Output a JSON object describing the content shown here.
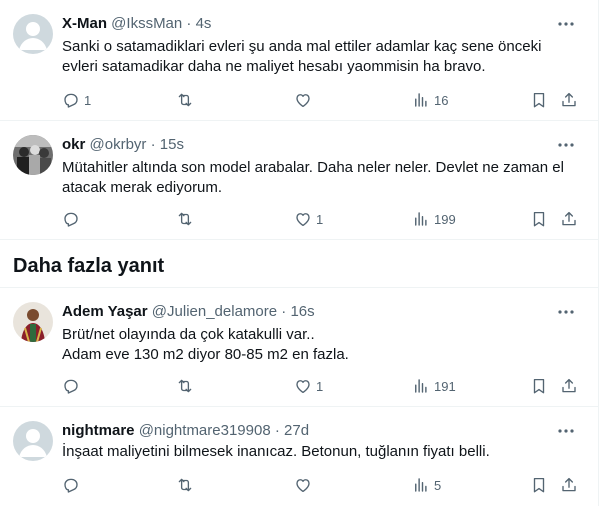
{
  "tweets": [
    {
      "name": "X-Man",
      "handle": "@IkssMan",
      "time": "4s",
      "lines": [
        "Sanki o satamadiklari evleri şu anda mal ettiler adamlar kaç sene önceki",
        "evleri satamadikar daha ne maliyet hesabı yaommisin ha bravo."
      ],
      "replies": "1",
      "retweets": "",
      "likes": "",
      "views": "16",
      "avatar": "default"
    },
    {
      "name": "okr",
      "handle": "@okrbyr",
      "time": "15s",
      "lines": [
        "Mütahitler altında son model arabalar. Daha neler neler. Devlet ne zaman el",
        "atacak merak ediyorum."
      ],
      "replies": "",
      "retweets": "",
      "likes": "1",
      "views": "199",
      "avatar": "photo-bw"
    },
    {
      "name": "Adem Yaşar",
      "handle": "@Julien_delamore",
      "time": "16s",
      "lines": [
        "Brüt/net olayında da çok katakulli var..",
        "Adam eve 130 m2 diyor 80-85 m2 en fazla."
      ],
      "replies": "",
      "retweets": "",
      "likes": "1",
      "views": "191",
      "avatar": "photo-color"
    },
    {
      "name": "nightmare",
      "handle": "@nightmare319908",
      "time": "27d",
      "lines": [
        "İnşaat maliyetini bilmesek inanıcaz. Betonun, tuğlanın  fiyatı belli."
      ],
      "replies": "",
      "retweets": "",
      "likes": "",
      "views": "5",
      "avatar": "default"
    }
  ],
  "more_replies_heading": "Daha fazla yanıt",
  "separator": "·",
  "icons": [
    "more-icon",
    "reply-icon",
    "retweet-icon",
    "like-icon",
    "views-icon",
    "bookmark-icon",
    "share-icon"
  ]
}
